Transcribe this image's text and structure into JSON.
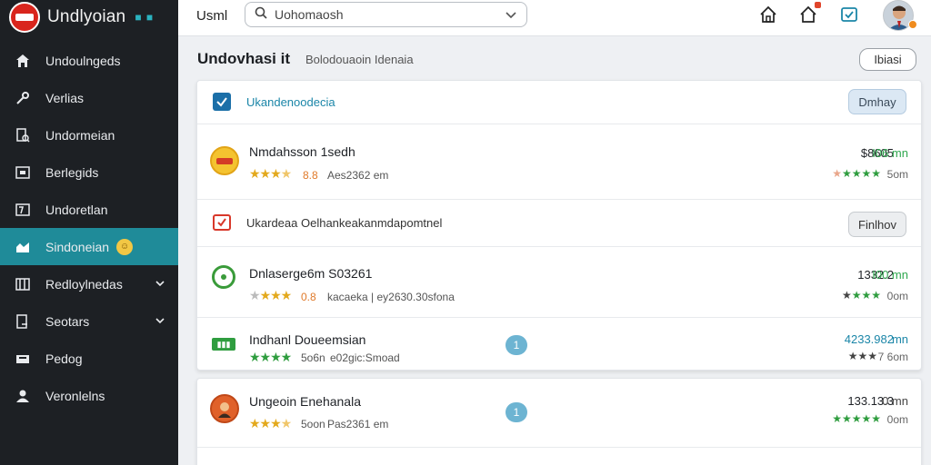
{
  "brand": {
    "name": "Undlyoian",
    "dots": "■ ■"
  },
  "sidebar": {
    "items": [
      {
        "label": "Undoulngeds",
        "icon": "home-icon"
      },
      {
        "label": "Verlias",
        "icon": "tools-icon"
      },
      {
        "label": "Undormeian",
        "icon": "document-search-icon"
      },
      {
        "label": "Berlegids",
        "icon": "image-icon"
      },
      {
        "label": "Undoretlan",
        "icon": "table-icon"
      },
      {
        "label": "Sindoneian",
        "icon": "dashboard-icon",
        "active": true
      },
      {
        "label": "Redloylnedas",
        "icon": "panel-icon"
      },
      {
        "label": "Seotars",
        "icon": "login-icon"
      },
      {
        "label": "Pedog",
        "icon": "printer-icon"
      },
      {
        "label": "Veronlelns",
        "icon": "user-icon"
      }
    ],
    "active_color": "#1f8b99"
  },
  "topbar": {
    "label": "Usml",
    "search": {
      "value": "Uohomaosh",
      "placeholder": "Uohomaosh"
    }
  },
  "page": {
    "title": "Undovhasi it",
    "subtitle": "Bolodouaoin Idenaia",
    "header_button": "Ibiasi"
  },
  "sections": [
    {
      "label": "Ukandenoodecia",
      "button": "Dmhay",
      "label_color": "#1b86a8"
    },
    {
      "label": "Ukardeaa Oelhankeakanmdapomtnel",
      "button": "Finlhov",
      "label_color": "#333333"
    }
  ],
  "items": [
    {
      "name": "Nmdahsson 1sedh",
      "rating": "8.8",
      "meta": "Aes2362 em",
      "price": "$8605",
      "price_suffix": "I06 mn",
      "sub": "5om",
      "icon": "coin-icon",
      "accent": "#2fa84f"
    },
    {
      "name": "Dnlaserge6m S03261",
      "rating": "0.8",
      "meta": "kacaeka | ey2630.30sfona",
      "price": "1332.2",
      "price_suffix": "I00 mn",
      "sub": "0om",
      "icon": "ring-icon",
      "accent": "#2fa84f"
    },
    {
      "name": "Indhanl Doueemsian",
      "rating": "5o6n",
      "meta": "e02gic:Smoad",
      "price": "4233.982",
      "price_suffix": "mn",
      "sub": "7 6om",
      "icon": "label-icon",
      "accent": "#1b86a8",
      "count": "1"
    },
    {
      "name": "Ungeoin Enehanala",
      "rating": "5oon",
      "meta": "Pas2361 em",
      "price": "133.13.3",
      "price_suffix": "0 mn",
      "sub": "0om",
      "icon": "avatar-icon",
      "accent": "#2fa84f",
      "count": "1"
    }
  ],
  "colors": {
    "teal": "#1f8b99",
    "star_gold": "#e3a91d",
    "star_green": "#2f9d3f"
  }
}
